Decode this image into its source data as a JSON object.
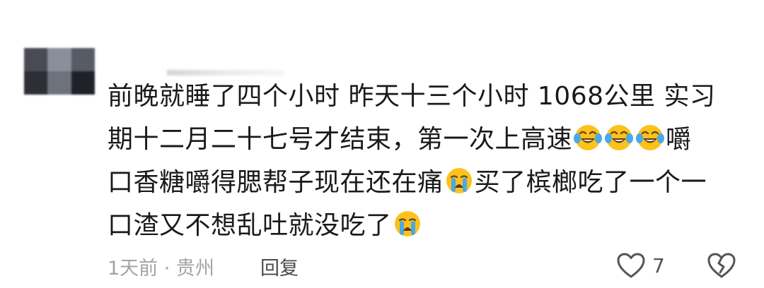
{
  "comment": {
    "lines": [
      "前晚就睡了四个小时  昨天十三个小时 1068公里  实习",
      "期十二月二十七号才结束，第一次上高速",
      "嚼",
      "口香糖嚼得腮帮子现在还在痛",
      "买了槟榔吃了一个一",
      "口渣又不想乱吐就没吃了"
    ]
  },
  "meta": {
    "time_location": "1天前 · 贵州",
    "reply_label": "回复",
    "like_count": "7"
  },
  "icons": {
    "laugh_cry": "face-with-tears-of-joy",
    "crying": "loudly-crying-face",
    "like": "heart-outline",
    "dislike": "broken-heart-outline"
  },
  "colors": {
    "text": "#1a1a1a",
    "meta": "#a3a3a3",
    "emoji_face": "#fcc21b",
    "emoji_tear": "#4aa8e8"
  }
}
